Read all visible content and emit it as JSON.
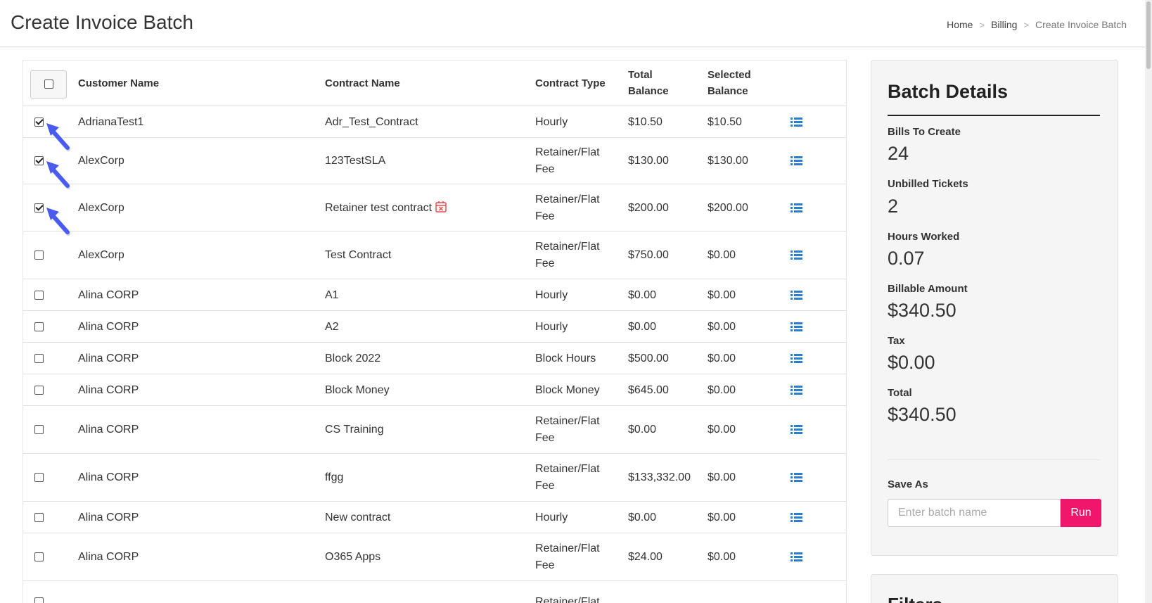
{
  "header": {
    "title": "Create Invoice Batch",
    "breadcrumb": [
      {
        "label": "Home",
        "separator": ">"
      },
      {
        "label": "Billing",
        "separator": ">"
      },
      {
        "label": "Create Invoice Batch"
      }
    ]
  },
  "table": {
    "columns": {
      "customer": "Customer Name",
      "contract": "Contract Name",
      "type": "Contract Type",
      "total_line1": "Total",
      "total_line2": "Balance",
      "selected_line1": "Selected",
      "selected_line2": "Balance"
    },
    "rows": [
      {
        "checked": true,
        "customer": "AdrianaTest1",
        "contract": "Adr_Test_Contract",
        "type": "Hourly",
        "type_line2": "",
        "total": "$10.50",
        "selected": "$10.50"
      },
      {
        "checked": true,
        "customer": "AlexCorp",
        "contract": "123TestSLA",
        "type": "Retainer/Flat",
        "type_line2": "Fee",
        "total": "$130.00",
        "selected": "$130.00"
      },
      {
        "checked": true,
        "customer": "AlexCorp",
        "contract": "Retainer test contract",
        "type": "Retainer/Flat",
        "type_line2": "Fee",
        "total": "$200.00",
        "selected": "$200.00",
        "has_calendar_icon": true
      },
      {
        "checked": false,
        "customer": "AlexCorp",
        "contract": "Test Contract",
        "type": "Retainer/Flat",
        "type_line2": "Fee",
        "total": "$750.00",
        "selected": "$0.00"
      },
      {
        "checked": false,
        "customer": "Alina CORP",
        "contract": "A1",
        "type": "Hourly",
        "type_line2": "",
        "total": "$0.00",
        "selected": "$0.00"
      },
      {
        "checked": false,
        "customer": "Alina CORP",
        "contract": "A2",
        "type": "Hourly",
        "type_line2": "",
        "total": "$0.00",
        "selected": "$0.00"
      },
      {
        "checked": false,
        "customer": "Alina CORP",
        "contract": "Block 2022",
        "type": "Block Hours",
        "type_line2": "",
        "total": "$500.00",
        "selected": "$0.00"
      },
      {
        "checked": false,
        "customer": "Alina CORP",
        "contract": "Block Money",
        "type": "Block Money",
        "type_line2": "",
        "total": "$645.00",
        "selected": "$0.00"
      },
      {
        "checked": false,
        "customer": "Alina CORP",
        "contract": "CS Training",
        "type": "Retainer/Flat",
        "type_line2": "Fee",
        "total": "$0.00",
        "selected": "$0.00"
      },
      {
        "checked": false,
        "customer": "Alina CORP",
        "contract": "ffgg",
        "type": "Retainer/Flat",
        "type_line2": "Fee",
        "total": "$133,332.00",
        "selected": "$0.00"
      },
      {
        "checked": false,
        "customer": "Alina CORP",
        "contract": "New contract",
        "type": "Hourly",
        "type_line2": "",
        "total": "$0.00",
        "selected": "$0.00"
      },
      {
        "checked": false,
        "customer": "Alina CORP",
        "contract": "O365 Apps",
        "type": "Retainer/Flat",
        "type_line2": "Fee",
        "total": "$24.00",
        "selected": "$0.00"
      },
      {
        "checked": false,
        "customer": "",
        "contract": "",
        "type": "Retainer/Flat",
        "type_line2": "",
        "total": "",
        "selected": ""
      }
    ]
  },
  "batch_details": {
    "title": "Batch Details",
    "stats": [
      {
        "label": "Bills To Create",
        "value": "24"
      },
      {
        "label": "Unbilled Tickets",
        "value": "2"
      },
      {
        "label": "Hours Worked",
        "value": "0.07"
      },
      {
        "label": "Billable Amount",
        "value": "$340.50"
      },
      {
        "label": "Tax",
        "value": "$0.00"
      },
      {
        "label": "Total",
        "value": "$340.50"
      }
    ],
    "save_as_label": "Save As",
    "batch_name_placeholder": "Enter batch name",
    "batch_name_value": "",
    "run_label": "Run"
  },
  "filters_card": {
    "title": "Filters"
  },
  "colors": {
    "accent_pink": "#f0166b",
    "link_blue": "#2f7ccc",
    "arrow_blue": "#4a5cf0",
    "calendar_red": "#e34d4d"
  },
  "icons": {
    "row_action": "list-icon",
    "annotation": "arrow-icon",
    "contract_flag": "calendar-x-icon"
  }
}
